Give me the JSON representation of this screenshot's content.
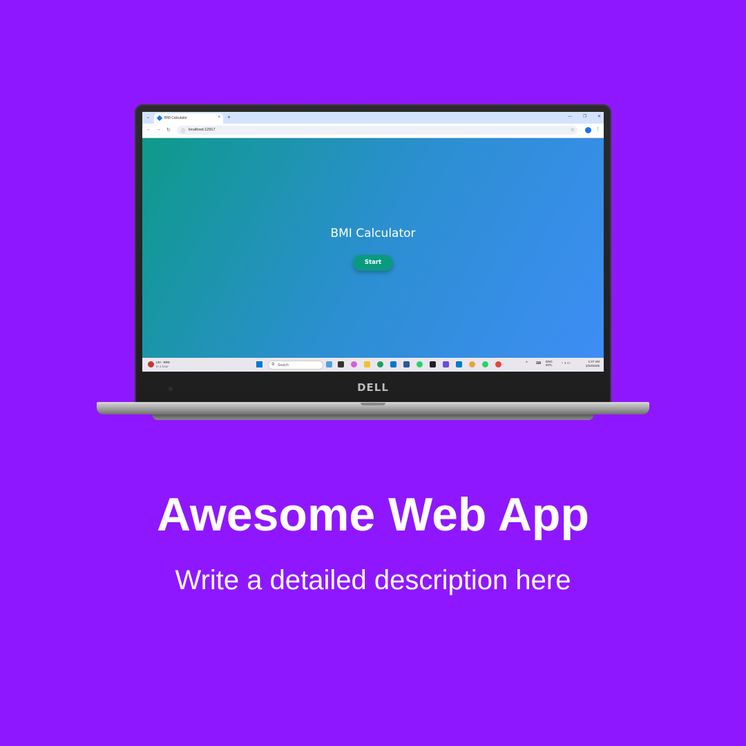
{
  "page": {
    "headline": "Awesome Web App",
    "subline": "Write a detailed description here",
    "background_color": "#8F17FF"
  },
  "laptop": {
    "brand": "DELL"
  },
  "browser": {
    "tab_title": "BMI Calculator",
    "tab_close": "×",
    "new_tab": "+",
    "url": "localhost:12917",
    "icons": [
      "chevron-down-icon",
      "favicon-icon",
      "close-icon",
      "plus-icon",
      "minimize-icon",
      "restore-icon",
      "close-window-icon",
      "back-icon",
      "forward-icon",
      "reload-icon",
      "info-icon",
      "star-icon",
      "profile-icon",
      "menu-icon"
    ]
  },
  "app": {
    "title": "BMI Calculator",
    "start_label": "Start",
    "gradient_start": "#0e9a8a",
    "gradient_end": "#3e8df5",
    "button_color": "#0a9a82"
  },
  "taskbar": {
    "weather_title": "LEI - BRE",
    "weather_sub": "In 1 hour",
    "search_placeholder": "Search",
    "lang_top": "ENG",
    "lang_bottom": "INTL",
    "time": "1:27 AM",
    "date": "2/22/2025",
    "app_icons": [
      "widgets-icon",
      "task-view-icon",
      "copilot-icon",
      "file-explorer-icon",
      "edge-icon",
      "outlook-icon",
      "word-icon",
      "whatsapp-icon",
      "terminal-icon",
      "app-icon",
      "vscode-icon",
      "chrome-profile-icon",
      "whatsapp-business-icon",
      "chrome-icon"
    ]
  }
}
